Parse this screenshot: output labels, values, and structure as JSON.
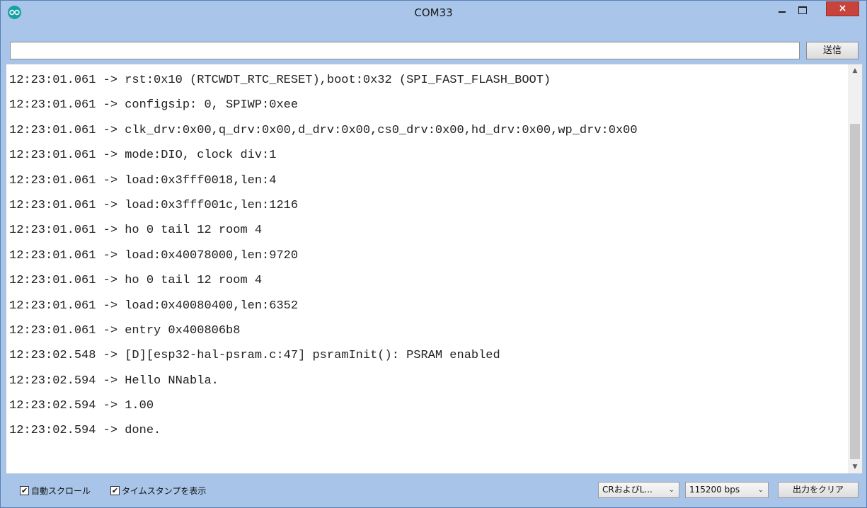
{
  "window": {
    "title": "COM33",
    "close_label": "×"
  },
  "input": {
    "value": "",
    "send_label": "送信"
  },
  "output": {
    "lines": [
      "12:23:01.061 -> rst:0x10 (RTCWDT_RTC_RESET),boot:0x32 (SPI_FAST_FLASH_BOOT)",
      "12:23:01.061 -> configsip: 0, SPIWP:0xee",
      "12:23:01.061 -> clk_drv:0x00,q_drv:0x00,d_drv:0x00,cs0_drv:0x00,hd_drv:0x00,wp_drv:0x00",
      "12:23:01.061 -> mode:DIO, clock div:1",
      "12:23:01.061 -> load:0x3fff0018,len:4",
      "12:23:01.061 -> load:0x3fff001c,len:1216",
      "12:23:01.061 -> ho 0 tail 12 room 4",
      "12:23:01.061 -> load:0x40078000,len:9720",
      "12:23:01.061 -> ho 0 tail 12 room 4",
      "12:23:01.061 -> load:0x40080400,len:6352",
      "12:23:01.061 -> entry 0x400806b8",
      "12:23:02.548 -> [D][esp32-hal-psram.c:47] psramInit(): PSRAM enabled",
      "12:23:02.594 -> Hello NNabla.",
      "12:23:02.594 -> 1.00",
      "12:23:02.594 -> done."
    ]
  },
  "status": {
    "autoscroll_label": "自動スクロール",
    "autoscroll_checked": true,
    "timestamp_label": "タイムスタンプを表示",
    "timestamp_checked": true,
    "line_ending": "CRおよびL...",
    "baud_rate": "115200 bps",
    "clear_label": "出力をクリア"
  },
  "icons": {
    "app": "arduino-icon",
    "minimize": "minimize-icon",
    "maximize": "maximize-icon",
    "close": "close-icon",
    "check": "checkmark-icon",
    "dropdown": "chevron-down-icon",
    "scroll_up": "scroll-up-arrow-icon",
    "scroll_down": "scroll-down-arrow-icon"
  },
  "colors": {
    "frame": "#a8c4e8",
    "close_button": "#c7443c",
    "app_icon": "#17a1a5"
  }
}
